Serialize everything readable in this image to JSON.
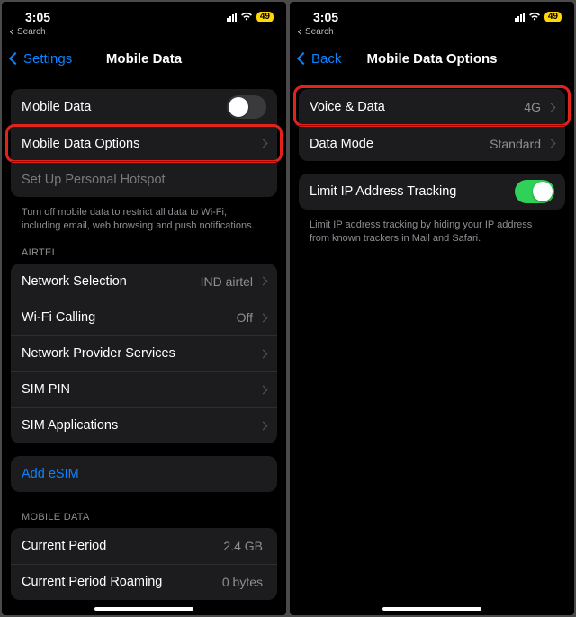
{
  "status": {
    "time": "3:05",
    "battery": "49"
  },
  "breadcrumb": "Search",
  "left": {
    "back": "Settings",
    "title": "Mobile Data",
    "rows": {
      "mobile_data": "Mobile Data",
      "options": "Mobile Data Options",
      "hotspot": "Set Up Personal Hotspot"
    },
    "footer1": "Turn off mobile data to restrict all data to Wi-Fi, including email, web browsing and push notifications.",
    "section_carrier": "AIRTEL",
    "carrier_rows": {
      "network_selection": {
        "label": "Network Selection",
        "value": "IND airtel"
      },
      "wifi_calling": {
        "label": "Wi-Fi Calling",
        "value": "Off"
      },
      "provider_services": {
        "label": "Network Provider Services"
      },
      "sim_pin": {
        "label": "SIM PIN"
      },
      "sim_apps": {
        "label": "SIM Applications"
      }
    },
    "add_esim": "Add eSIM",
    "section_usage": "MOBILE DATA",
    "usage_rows": {
      "current_period": {
        "label": "Current Period",
        "value": "2.4 GB"
      },
      "roaming": {
        "label": "Current Period Roaming",
        "value": "0 bytes"
      }
    }
  },
  "right": {
    "back": "Back",
    "title": "Mobile Data Options",
    "rows": {
      "voice_data": {
        "label": "Voice & Data",
        "value": "4G"
      },
      "data_mode": {
        "label": "Data Mode",
        "value": "Standard"
      }
    },
    "limit_ip": "Limit IP Address Tracking",
    "footer1": "Limit IP address tracking by hiding your IP address from known trackers in Mail and Safari."
  }
}
